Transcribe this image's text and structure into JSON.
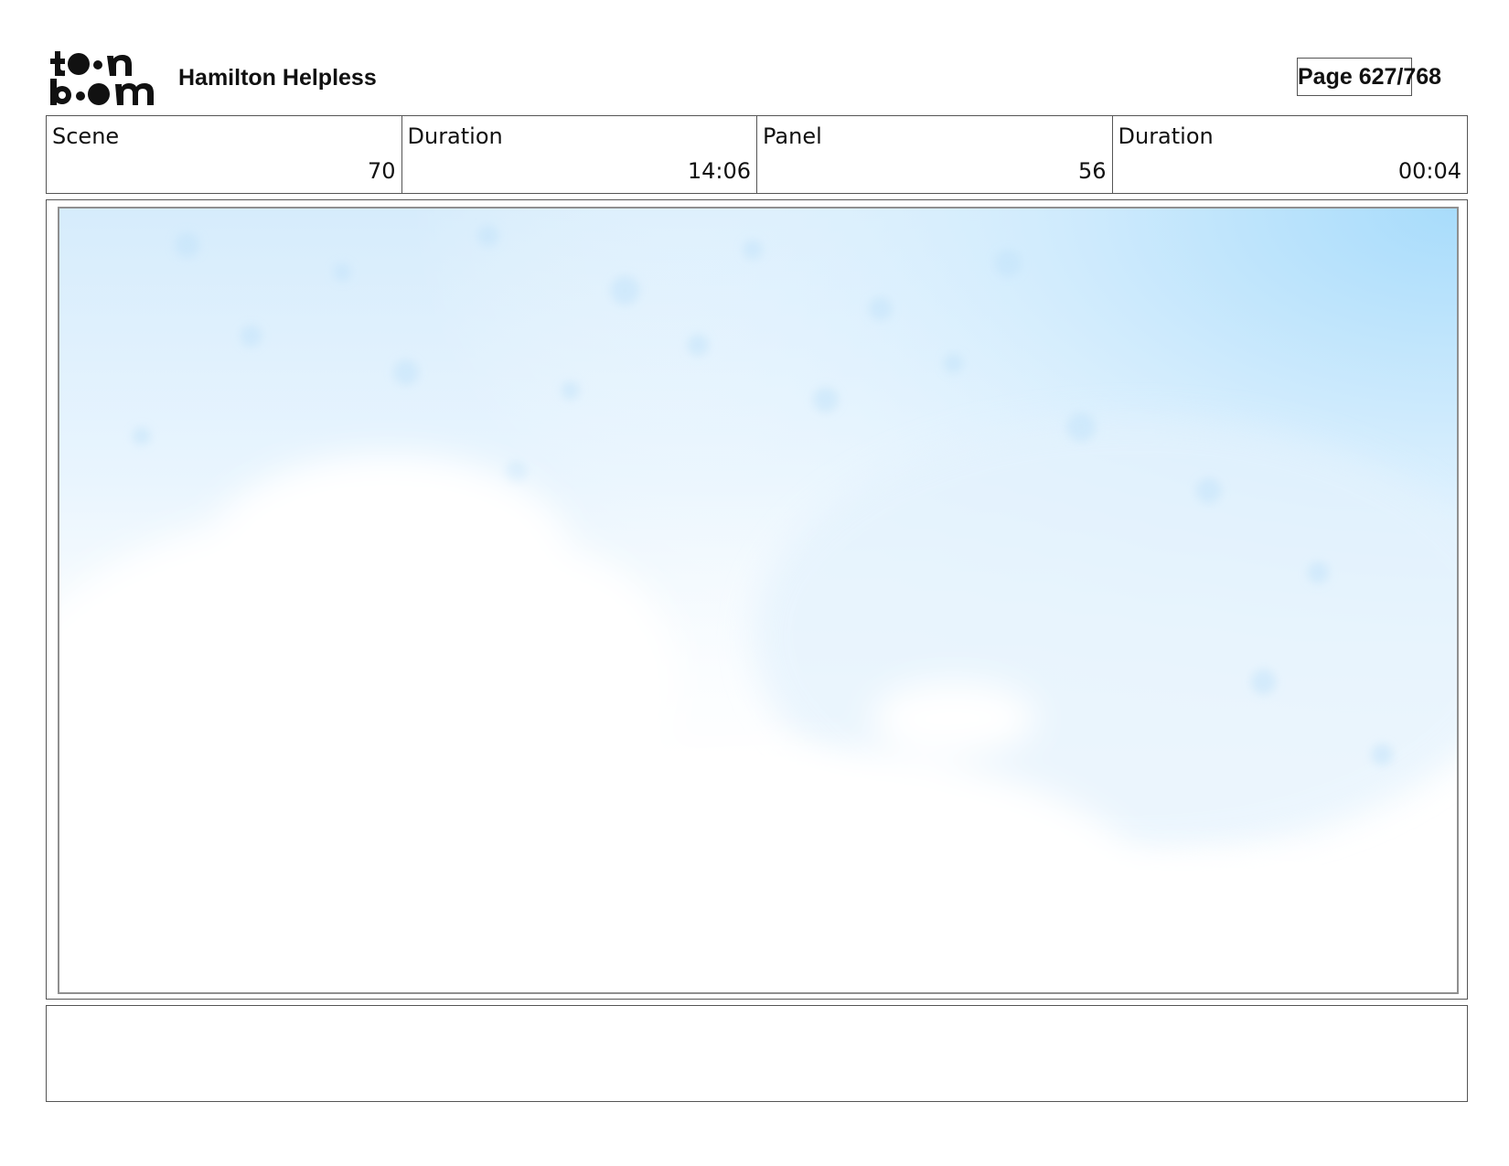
{
  "header": {
    "logo_icon": "toon-boom-logo-icon",
    "logo_text": "toon boom",
    "project_title": "Hamilton Helpless",
    "page_label": "Page 627/768"
  },
  "info": {
    "scene_label": "Scene",
    "scene_value": "70",
    "scene_duration_label": "Duration",
    "scene_duration_value": "14:06",
    "panel_label": "Panel",
    "panel_value": "56",
    "panel_duration_label": "Duration",
    "panel_duration_value": "00:04"
  },
  "panel": {
    "image_icon": "sky-clouds-drawing-icon",
    "sky_color": "#a8dcfb",
    "cloud_color": "#ffffff"
  },
  "caption": {
    "text": ""
  }
}
